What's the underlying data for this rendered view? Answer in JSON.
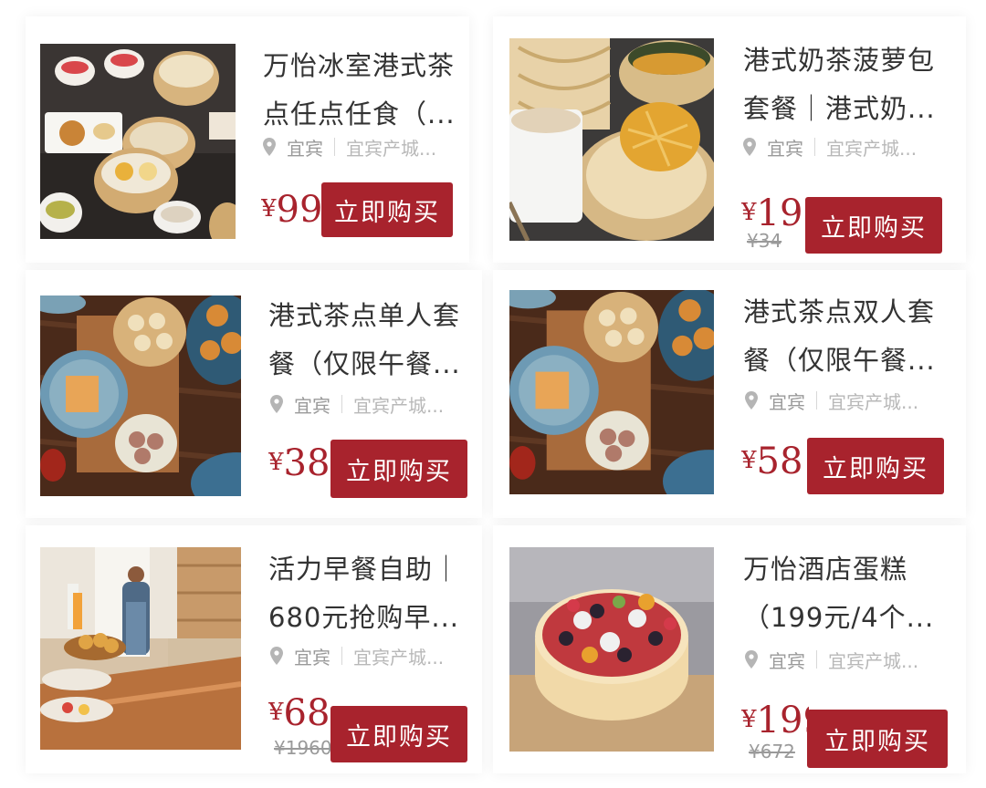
{
  "products": [
    {
      "title_line1": "万怡冰室港式茶",
      "title_line2": "点任点任食（...",
      "location": "宜宾",
      "address": "宜宾产城...",
      "currency": "¥",
      "price": "99",
      "original_price": "",
      "buy_label": "立即购买"
    },
    {
      "title_line1": "港式奶茶菠萝包",
      "title_line2": "套餐｜港式奶...",
      "location": "宜宾",
      "address": "宜宾产城...",
      "currency": "¥",
      "price": "19.",
      "original_price": "¥34",
      "buy_label": "立即购买"
    },
    {
      "title_line1": "港式茶点单人套",
      "title_line2": "餐（仅限午餐...",
      "location": "宜宾",
      "address": "宜宾产城...",
      "currency": "¥",
      "price": "38",
      "original_price": "",
      "buy_label": "立即购买"
    },
    {
      "title_line1": "港式茶点双人套",
      "title_line2": "餐（仅限午餐...",
      "location": "宜宾",
      "address": "宜宾产城...",
      "currency": "¥",
      "price": "58",
      "original_price": "",
      "buy_label": "立即购买"
    },
    {
      "title_line1": "活力早餐自助｜",
      "title_line2": "680元抢购早...",
      "location": "宜宾",
      "address": "宜宾产城...",
      "currency": "¥",
      "price": "68",
      "original_price": "¥1960",
      "buy_label": "立即购买"
    },
    {
      "title_line1": "万怡酒店蛋糕",
      "title_line2": "（199元/4个...",
      "location": "宜宾",
      "address": "宜宾产城...",
      "currency": "¥",
      "price": "199",
      "original_price": "¥672",
      "buy_label": "立即购买"
    }
  ],
  "colors": {
    "accent": "#a8232d",
    "title": "#333333",
    "muted": "#9a9a9a"
  }
}
